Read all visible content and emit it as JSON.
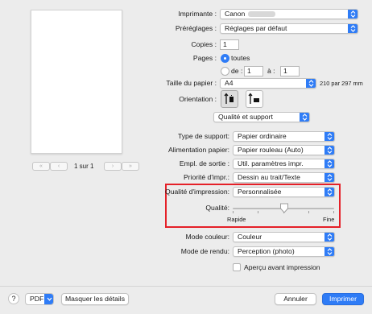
{
  "preview": {
    "page_indicator": "1 sur 1",
    "nav_first": "«",
    "nav_prev": "‹",
    "nav_next": "›",
    "nav_last": "»"
  },
  "printer": {
    "label": "Imprimante :",
    "value": "Canon"
  },
  "presets": {
    "label": "Préréglages :",
    "value": "Réglages par défaut"
  },
  "copies": {
    "label": "Copies :",
    "value": "1"
  },
  "pages": {
    "label": "Pages :",
    "all_label": "toutes",
    "from_label": "de :",
    "from_value": "1",
    "to_label": "à :",
    "to_value": "1"
  },
  "paper_size": {
    "label": "Taille du papier :",
    "value": "A4",
    "dimensions": "210 par 297 mm"
  },
  "orientation": {
    "label": "Orientation :"
  },
  "section": {
    "value": "Qualité et support"
  },
  "media_type": {
    "label": "Type de support:",
    "value": "Papier ordinaire"
  },
  "paper_source": {
    "label": "Alimentation papier:",
    "value": "Papier rouleau (Auto)"
  },
  "output_method": {
    "label": "Empl. de sortie :",
    "value": "Util. paramètres impr."
  },
  "print_priority": {
    "label": "Priorité d'impr.:",
    "value": "Dessin au trait/Texte"
  },
  "print_quality": {
    "label": "Qualité d'impression:",
    "value": "Personnalisée"
  },
  "quality_slider": {
    "label": "Qualité:",
    "min_label": "Rapide",
    "max_label": "Fine",
    "level_fraction": 0.5
  },
  "color_mode": {
    "label": "Mode couleur:",
    "value": "Couleur"
  },
  "rendering_mode": {
    "label": "Mode de rendu:",
    "value": "Perception (photo)"
  },
  "preview_before_print": {
    "label": "Aperçu avant impression",
    "checked": false
  },
  "footer": {
    "help": "?",
    "pdf": "PDF",
    "hide_details": "Masquer les détails",
    "cancel": "Annuler",
    "print": "Imprimer"
  },
  "colors": {
    "accent": "#2f7cf6",
    "highlight_border": "#e52028"
  }
}
